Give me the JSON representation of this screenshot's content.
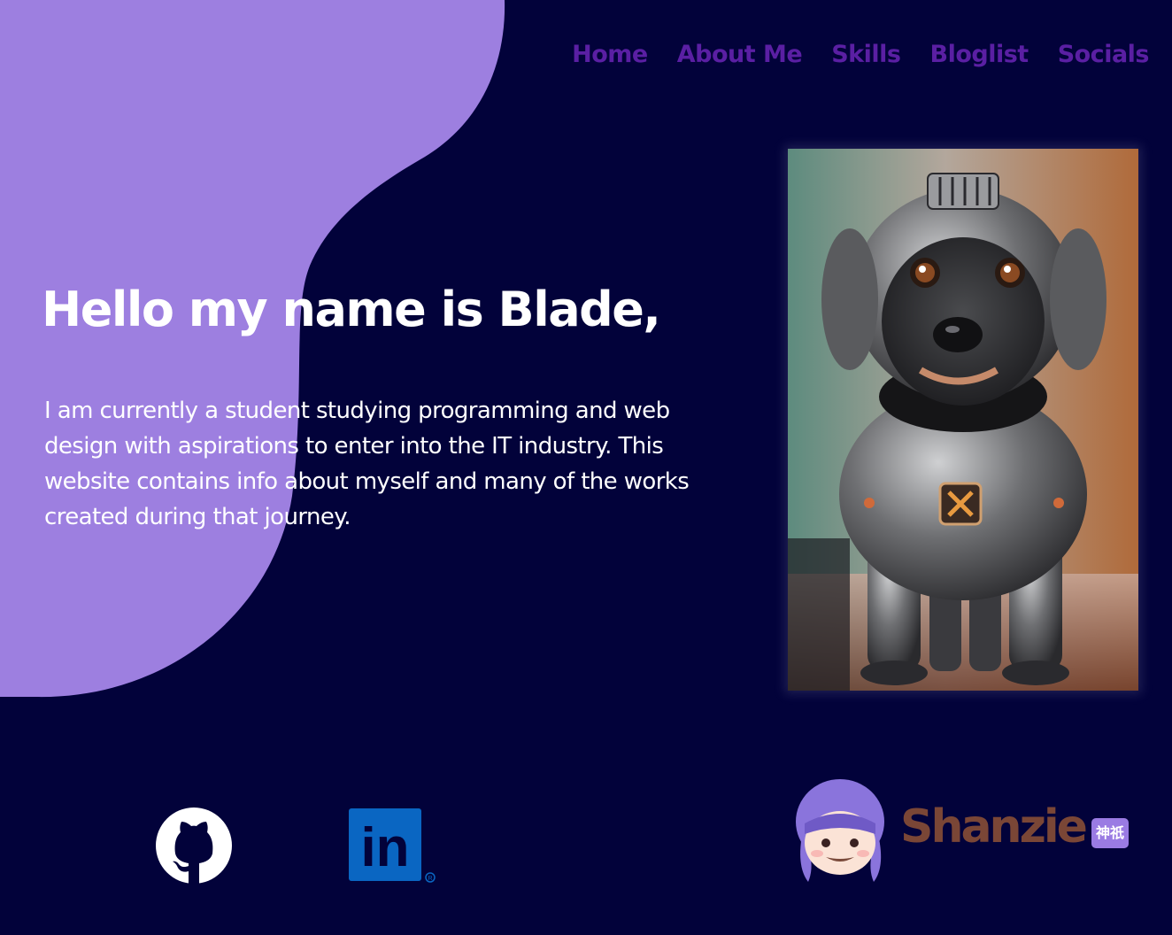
{
  "nav": {
    "items": [
      {
        "label": "Home"
      },
      {
        "label": "About Me"
      },
      {
        "label": "Skills"
      },
      {
        "label": "Bloglist"
      },
      {
        "label": "Socials"
      }
    ]
  },
  "hero": {
    "title": "Hello my name is Blade,",
    "description": "I am currently a student studying programming and web design with aspirations to enter into the IT industry. This website contains info about myself and many of the works created during that journey."
  },
  "portrait": {
    "icon": "robot-dog-image"
  },
  "socials": {
    "github_icon": "github-icon",
    "linkedin_icon": "linkedin-icon",
    "linkedin_text": "in"
  },
  "brand": {
    "name": "Shanzie",
    "tag": "神祇"
  },
  "colors": {
    "background": "#02023a",
    "blob": "#9d7fe0",
    "nav": "#5a1fa3",
    "text": "#ffffff",
    "linkedin": "#0a66c2"
  }
}
